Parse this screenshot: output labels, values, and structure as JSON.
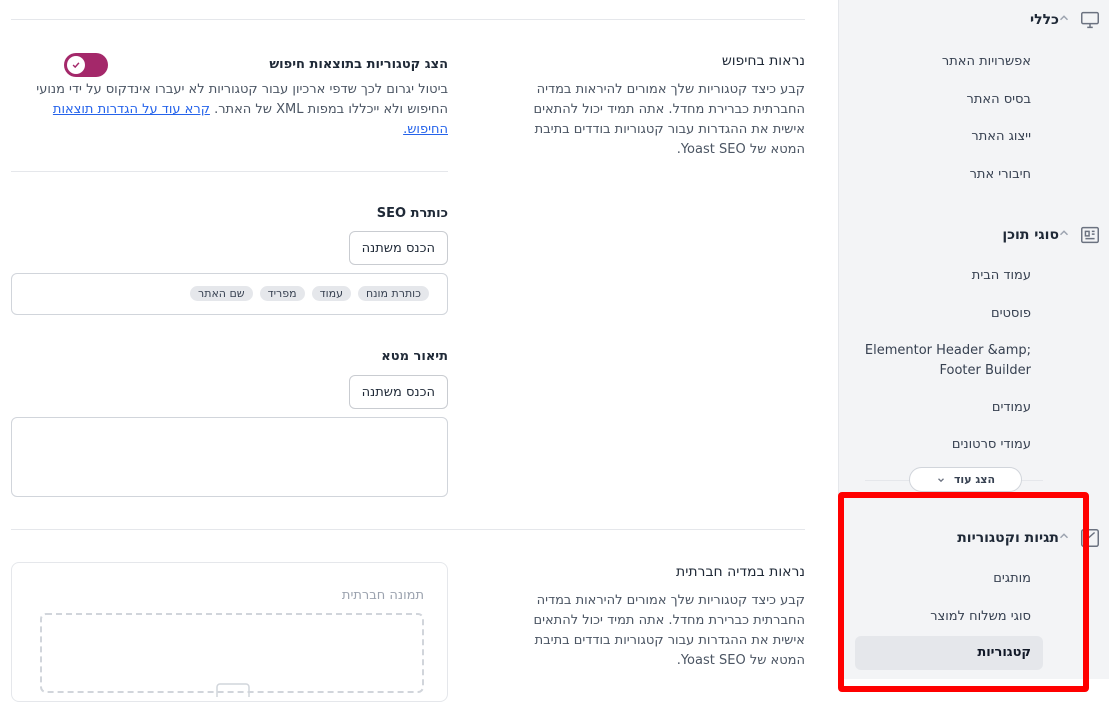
{
  "sidebar": {
    "general": {
      "title": "כללי",
      "items": [
        "אפשרויות האתר",
        "בסיס האתר",
        "ייצוג האתר",
        "חיבורי אתר"
      ]
    },
    "content_types": {
      "title": "סוגי תוכן",
      "items": [
        "עמוד הבית",
        "פוסטים",
        "Elementor Header &amp; Footer Builder",
        "עמודים",
        "עמודי סרטונים"
      ],
      "show_more": "הצג עוד"
    },
    "taxonomies": {
      "title": "תגיות וקטגוריות",
      "items": [
        "מותגים",
        "סוגי משלוח למוצר",
        "קטגוריות"
      ],
      "active": "קטגוריות"
    },
    "highlight_color": "#ff0000"
  },
  "search_appearance": {
    "title": "נראות בחיפוש",
    "description": "קבע כיצד קטגוריות שלך אמורים להיראות במדיה החברתית כברירת מחדל. אתה תמיד יכול להתאים אישית את ההגדרות עבור קטגוריות בודדים בתיבת המטא של Yoast SEO.",
    "toggle_label": "הצג קטגוריות בתוצאות חיפוש",
    "toggle_on": true,
    "toggle_help": "ביטול יגרום לכך שדפי ארכיון עבור קטגוריות לא יעברו אינדקוס על ידי מנועי החיפוש ולא ייכללו במפות XML של האתר.",
    "toggle_link": "קרא עוד על הגדרות תוצאות החיפוש."
  },
  "seo_title": {
    "label": "כותרת SEO",
    "insert_variable": "הכנס משתנה",
    "chips": [
      "כותרת מונח",
      "עמוד",
      "מפריד",
      "שם האתר"
    ]
  },
  "meta_description": {
    "label": "תיאור מטא",
    "insert_variable": "הכנס משתנה"
  },
  "social_appearance": {
    "title": "נראות במדיה חברתית",
    "description": "קבע כיצד קטגוריות שלך אמורים להיראות במדיה החברתית כברירת מחדל. אתה תמיד יכול להתאים אישית את ההגדרות עבור קטגוריות בודדים בתיבת המטא של Yoast SEO.",
    "image_label": "תמונה חברתית"
  },
  "colors": {
    "accent": "#a4286a",
    "link": "#2563eb"
  }
}
